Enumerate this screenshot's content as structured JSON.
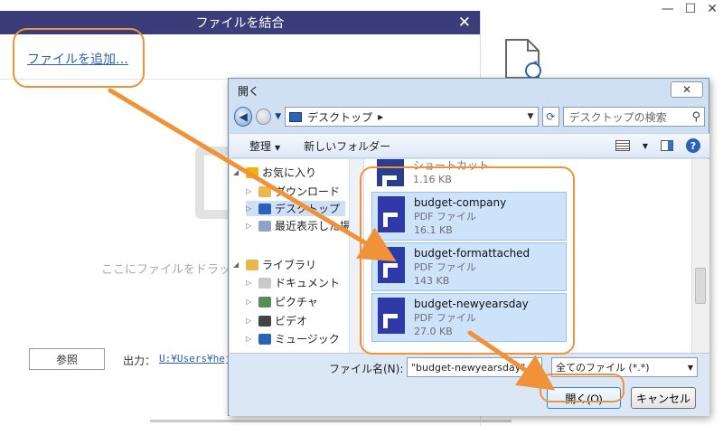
{
  "merge_dialog": {
    "title": "ファイルを結合",
    "add_file_link": "ファイルを追加…",
    "drop_hint": "ここにファイルをドラッ",
    "browse_button": "参照",
    "output_label": "出力：",
    "output_path": "U:¥Users¥heji"
  },
  "open_dialog": {
    "title": "開く",
    "close_label": "✕",
    "address": "デスクトップ",
    "address_separator": "▸",
    "search_placeholder": "デスクトップの検索",
    "commands": {
      "organize": "整理",
      "new_folder": "新しいフォルダー"
    },
    "nav_items": [
      {
        "label": "お気に入り",
        "icon": "star-icon",
        "color": "#f2b300",
        "level": 0
      },
      {
        "label": "ダウンロード",
        "icon": "download-folder-icon",
        "color": "#e8b84a",
        "level": 1
      },
      {
        "label": "デスクトップ",
        "icon": "desktop-icon",
        "color": "#2a62b8",
        "level": 1,
        "selected": true
      },
      {
        "label": "最近表示した場所",
        "icon": "recent-places-icon",
        "color": "#8ea4c4",
        "level": 1
      },
      {
        "label": "ライブラリ",
        "icon": "library-icon",
        "color": "#e8b84a",
        "level": 0
      },
      {
        "label": "ドキュメント",
        "icon": "documents-icon",
        "color": "#c9c9c9",
        "level": 1
      },
      {
        "label": "ピクチャ",
        "icon": "pictures-icon",
        "color": "#5a8c5a",
        "level": 1
      },
      {
        "label": "ビデオ",
        "icon": "videos-icon",
        "color": "#444444",
        "level": 1
      },
      {
        "label": "ミュージック",
        "icon": "music-icon",
        "color": "#2a62b8",
        "level": 1
      }
    ],
    "files": [
      {
        "name": "ショートカット",
        "type": "",
        "size": "1.16 KB",
        "icon": "shortcut-icon"
      },
      {
        "name": "budget-company",
        "type": "PDF ファイル",
        "size": "16.1 KB",
        "icon": "pdf-file-icon"
      },
      {
        "name": "budget-formattached",
        "type": "PDF ファイル",
        "size": "143 KB",
        "icon": "pdf-file-icon"
      },
      {
        "name": "budget-newyearsday",
        "type": "PDF ファイル",
        "size": "27.0 KB",
        "icon": "pdf-file-icon"
      }
    ],
    "filename_label": "ファイル名(N):",
    "filename_value": "\"budget-newyearsday\" \"b",
    "filetype_value": "全てのファイル (*.*)",
    "open_button": "開く(O)",
    "cancel_button": "キャンセル"
  },
  "colors": {
    "merge_titlebar": "#3a3d7a",
    "highlight": "#f0923a",
    "link": "#2a5fb5",
    "open_dialog_frame": "#cfe0f3",
    "pdf_icon": "#2f3aa8"
  }
}
